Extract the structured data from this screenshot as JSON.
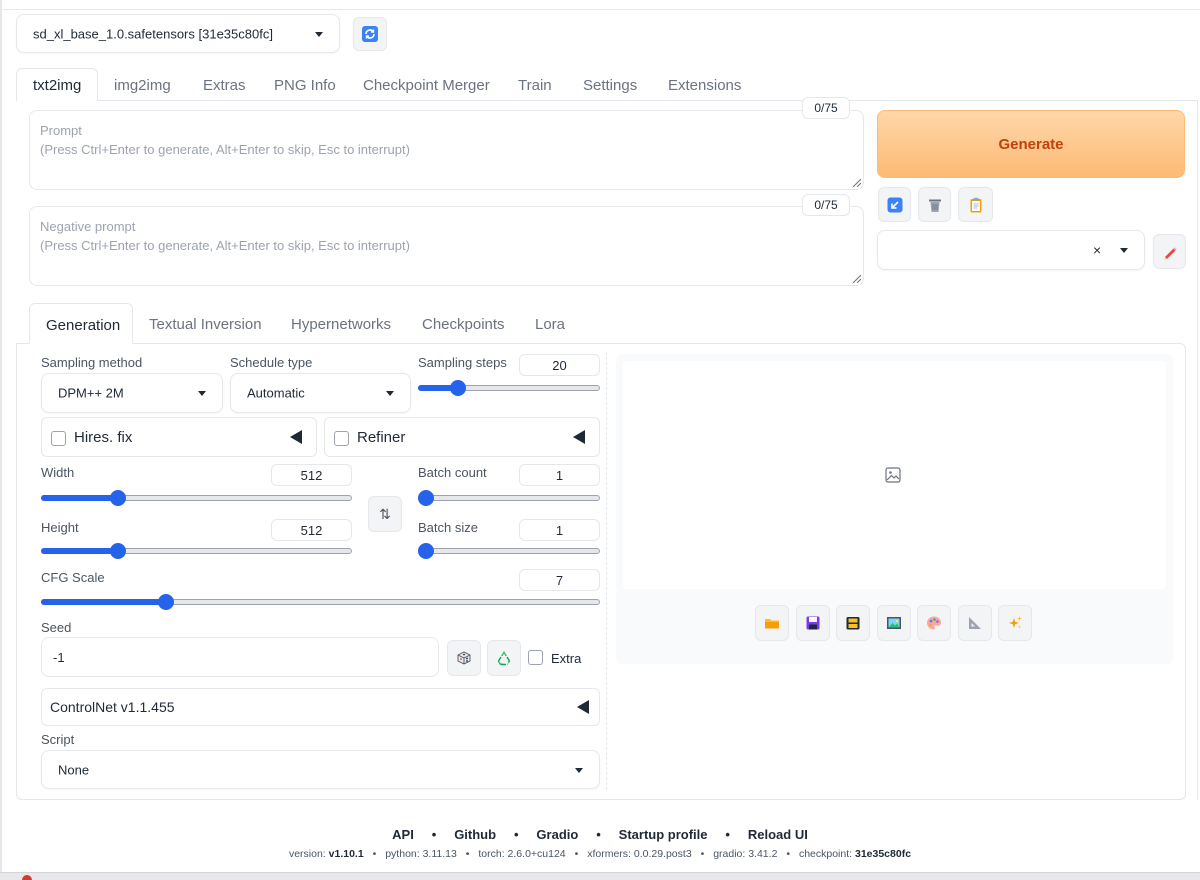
{
  "model": {
    "checkpoint": "sd_xl_base_1.0.safetensors [31e35c80fc]",
    "refresh_icon": "refresh-icon"
  },
  "main_tabs": [
    {
      "label": "txt2img"
    },
    {
      "label": "img2img"
    },
    {
      "label": "Extras"
    },
    {
      "label": "PNG Info"
    },
    {
      "label": "Checkpoint Merger"
    },
    {
      "label": "Train"
    },
    {
      "label": "Settings"
    },
    {
      "label": "Extensions"
    }
  ],
  "prompt": {
    "label": "Prompt",
    "placeholder": "(Press Ctrl+Enter to generate, Alt+Enter to skip, Esc to interrupt)",
    "counter": "0/75"
  },
  "negative_prompt": {
    "label": "Negative prompt",
    "placeholder": "(Press Ctrl+Enter to generate, Alt+Enter to skip, Esc to interrupt)",
    "counter": "0/75"
  },
  "generate_label": "Generate",
  "sub_tabs": [
    {
      "label": "Generation"
    },
    {
      "label": "Textual Inversion"
    },
    {
      "label": "Hypernetworks"
    },
    {
      "label": "Checkpoints"
    },
    {
      "label": "Lora"
    }
  ],
  "params": {
    "sampling_method_label": "Sampling method",
    "sampling_method": "DPM++ 2M",
    "schedule_type_label": "Schedule type",
    "schedule_type": "Automatic",
    "sampling_steps_label": "Sampling steps",
    "sampling_steps": "20",
    "hires_fix_label": "Hires. fix",
    "refiner_label": "Refiner",
    "width_label": "Width",
    "width": "512",
    "height_label": "Height",
    "height": "512",
    "batch_count_label": "Batch count",
    "batch_count": "1",
    "batch_size_label": "Batch size",
    "batch_size": "1",
    "cfg_scale_label": "CFG Scale",
    "cfg_scale": "7",
    "seed_label": "Seed",
    "seed": "-1",
    "extra_label": "Extra",
    "controlnet_label": "ControlNet v1.1.455",
    "script_label": "Script",
    "script": "None",
    "swap_icon": "⇅",
    "slider_levels": {
      "sampling_steps": 0.19,
      "width": 0.235,
      "height": 0.235,
      "batch_count": 0.0,
      "batch_size": 0.0,
      "cfg_scale": 0.215
    }
  },
  "footer": {
    "links": [
      "API",
      "Github",
      "Gradio",
      "Startup profile",
      "Reload UI"
    ],
    "separator": "•",
    "version_label": "version:",
    "version": "v1.10.1",
    "python": "python: 3.11.13",
    "torch": "torch: 2.6.0+cu124",
    "xformers": "xformers: 0.0.29.post3",
    "gradio": "gradio: 3.41.2",
    "checkpoint_label": "checkpoint:",
    "checkpoint": "31e35c80fc"
  },
  "colors": {
    "accent": "#2563eb",
    "generate_bg": "#fdba74",
    "generate_text": "#c2410c"
  }
}
